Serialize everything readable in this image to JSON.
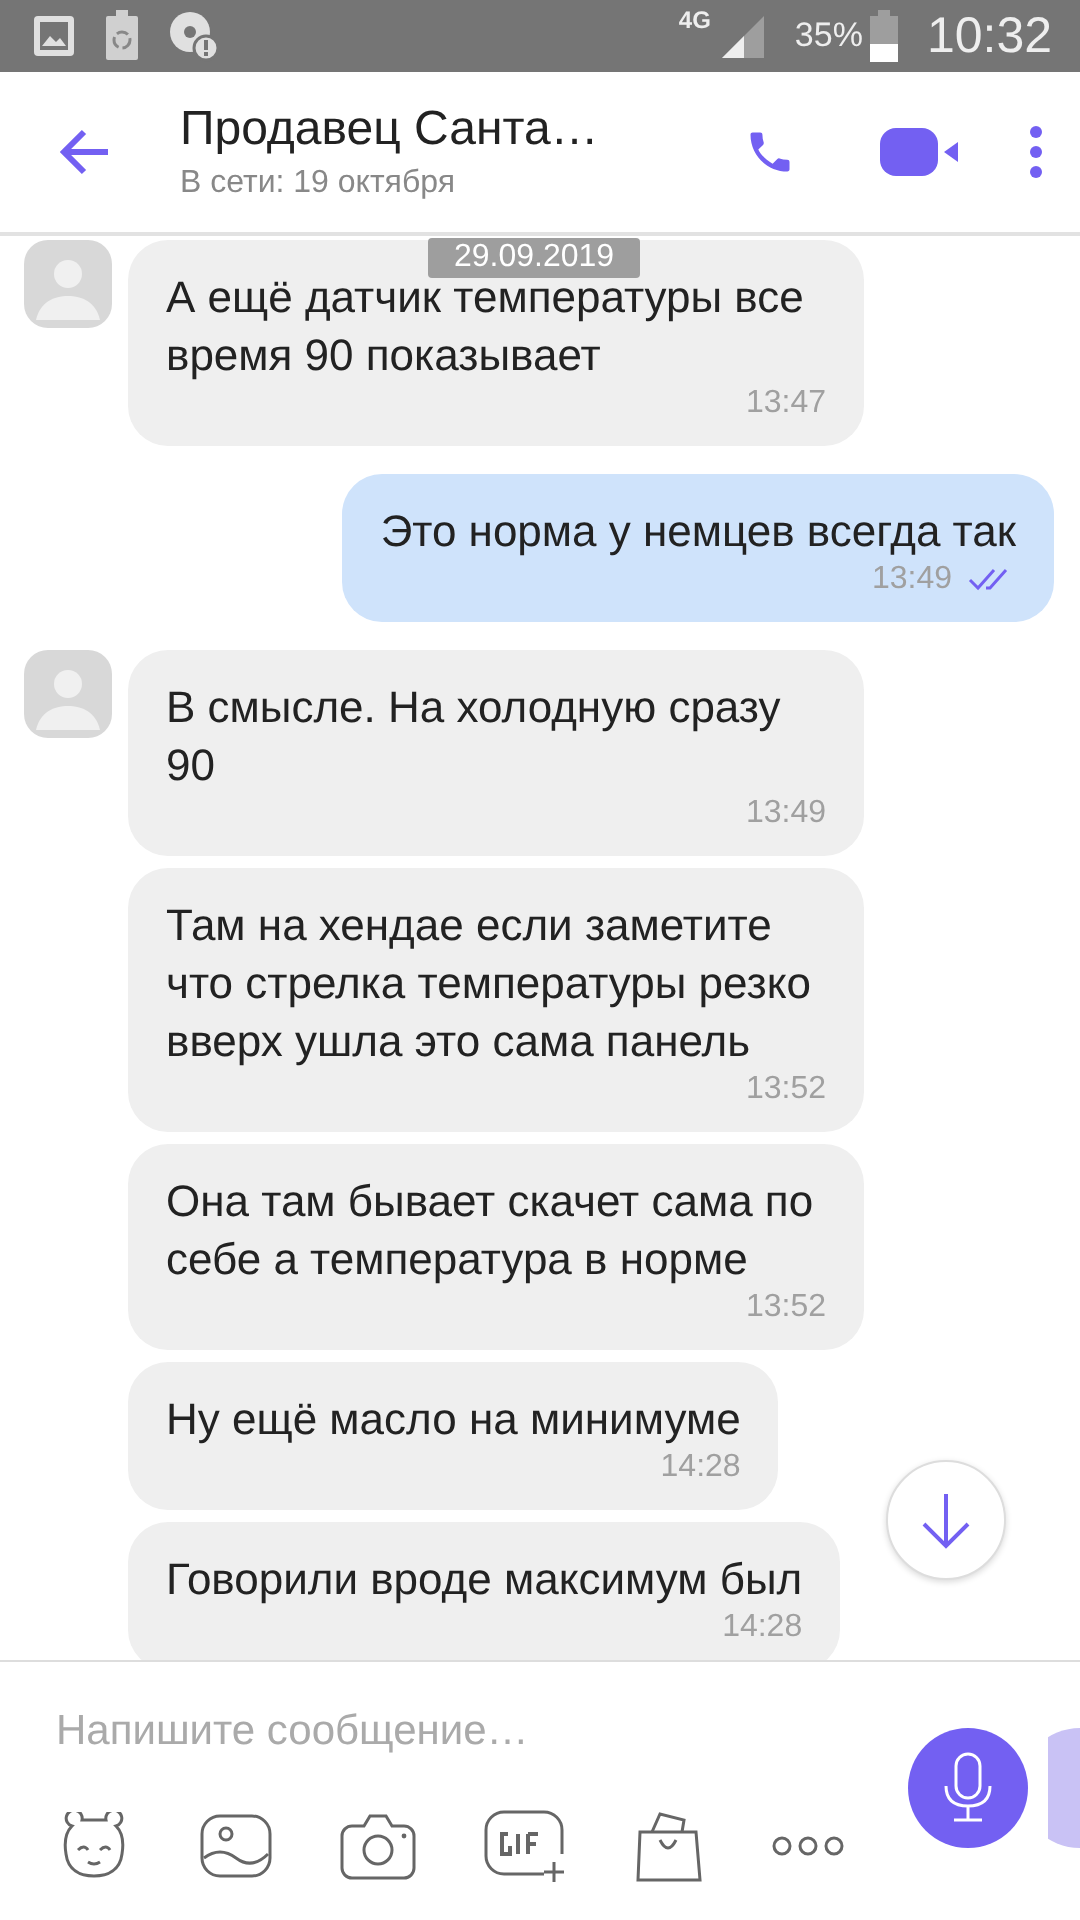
{
  "status_bar": {
    "network": "4G",
    "battery": "35%",
    "time": "10:32"
  },
  "header": {
    "title": "Продавец Санта…",
    "subtitle": "В сети: 19 октября"
  },
  "date_label": "29.09.2019",
  "messages": [
    {
      "kind": "incoming",
      "avatar": true,
      "text": "А ещё датчик температуры все время 90 показывает",
      "time": "13:47"
    },
    {
      "kind": "outgoing",
      "text": "Это норма у немцев всегда так",
      "time": "13:49",
      "seen": true
    },
    {
      "kind": "incoming",
      "avatar": true,
      "text": "В смысле. На холодную сразу 90",
      "time": "13:49"
    },
    {
      "kind": "incoming",
      "avatar": false,
      "text": "Там на хендае если заметите что стрелка температуры резко вверх ушла это сама панель",
      "time": "13:52"
    },
    {
      "kind": "incoming",
      "avatar": false,
      "text": "Она там бывает скачет сама по себе а температура в норме",
      "time": "13:52"
    },
    {
      "kind": "incoming",
      "avatar": false,
      "text": "Ну ещё масло на минимуме",
      "time": "14:28"
    },
    {
      "kind": "incoming",
      "avatar": false,
      "text": "Говорили вроде максимум был",
      "time": "14:28"
    }
  ],
  "composer": {
    "placeholder": "Напишите сообщение…"
  }
}
